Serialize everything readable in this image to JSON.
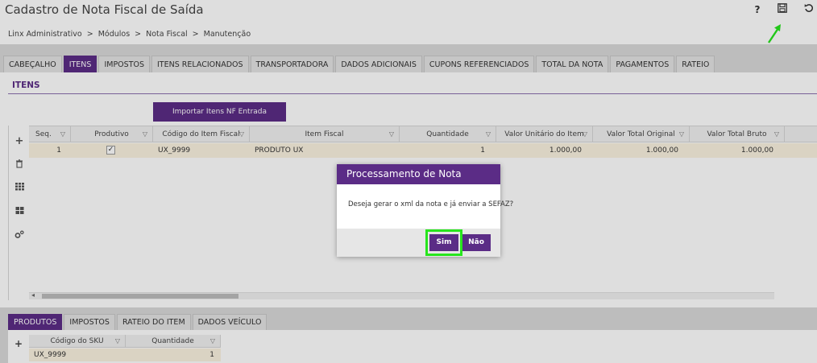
{
  "header": {
    "title": "Cadastro de Nota Fiscal de Saída",
    "breadcrumb": [
      "Linx Administrativo",
      "Módulos",
      "Nota Fiscal",
      "Manutenção"
    ],
    "breadcrumb_separator": ">",
    "help_icon": "?",
    "save_icon": "floppy-disk-icon",
    "refresh_icon": "refresh-icon"
  },
  "main_tabs": [
    {
      "label": "CABEÇALHO",
      "active": false
    },
    {
      "label": "ITENS",
      "active": true
    },
    {
      "label": "IMPOSTOS",
      "active": false
    },
    {
      "label": "ITENS RELACIONADOS",
      "active": false
    },
    {
      "label": "TRANSPORTADORA",
      "active": false
    },
    {
      "label": "DADOS ADICIONAIS",
      "active": false
    },
    {
      "label": "CUPONS REFERENCIADOS",
      "active": false
    },
    {
      "label": "TOTAL DA NOTA",
      "active": false
    },
    {
      "label": "PAGAMENTOS",
      "active": false
    },
    {
      "label": "RATEIO",
      "active": false
    }
  ],
  "itens": {
    "section_title": "ITENS",
    "import_button": "Importar Itens NF Entrada",
    "toolbar_icons": [
      "plus-icon",
      "trash-icon",
      "grid-icon",
      "tiles-icon",
      "settings-icon"
    ],
    "columns": [
      "Seq.",
      "Produtivo",
      "Código do Item Fiscal",
      "Item Fiscal",
      "Quantidade",
      "Valor Unitário do Item",
      "Valor Total Original",
      "Valor Total Bruto"
    ],
    "rows": [
      {
        "seq": "1",
        "produtivo": true,
        "codigo": "UX_9999",
        "item": "PRODUTO UX",
        "quantidade": "1",
        "valor_unitario": "1.000,00",
        "valor_total_original": "1.000,00",
        "valor_total_bruto": "1.000,00"
      }
    ]
  },
  "dialog": {
    "title": "Processamento de Nota",
    "message": "Deseja gerar o xml da nota e já enviar a SEFAZ?",
    "yes_label": "Sim",
    "no_label": "Não"
  },
  "bottom_tabs": [
    {
      "label": "PRODUTOS",
      "active": true
    },
    {
      "label": "IMPOSTOS",
      "active": false
    },
    {
      "label": "RATEIO DO ITEM",
      "active": false
    },
    {
      "label": "DADOS VEÍCULO",
      "active": false
    }
  ],
  "sku_grid": {
    "columns": [
      "Código do SKU",
      "Quantidade"
    ],
    "rows": [
      {
        "codigo": "UX_9999",
        "quantidade": "1"
      }
    ]
  },
  "colors": {
    "accent": "#5b2c86",
    "highlight": "#27e51d",
    "selected_row": "#fbf3e1"
  }
}
